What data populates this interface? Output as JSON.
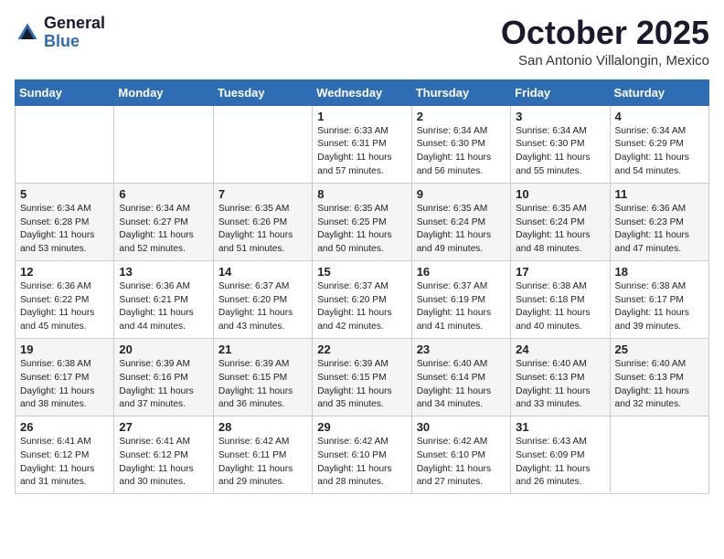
{
  "header": {
    "logo_general": "General",
    "logo_blue": "Blue",
    "month": "October 2025",
    "location": "San Antonio Villalongin, Mexico"
  },
  "weekdays": [
    "Sunday",
    "Monday",
    "Tuesday",
    "Wednesday",
    "Thursday",
    "Friday",
    "Saturday"
  ],
  "weeks": [
    [
      {
        "day": "",
        "info": ""
      },
      {
        "day": "",
        "info": ""
      },
      {
        "day": "",
        "info": ""
      },
      {
        "day": "1",
        "info": "Sunrise: 6:33 AM\nSunset: 6:31 PM\nDaylight: 11 hours\nand 57 minutes."
      },
      {
        "day": "2",
        "info": "Sunrise: 6:34 AM\nSunset: 6:30 PM\nDaylight: 11 hours\nand 56 minutes."
      },
      {
        "day": "3",
        "info": "Sunrise: 6:34 AM\nSunset: 6:30 PM\nDaylight: 11 hours\nand 55 minutes."
      },
      {
        "day": "4",
        "info": "Sunrise: 6:34 AM\nSunset: 6:29 PM\nDaylight: 11 hours\nand 54 minutes."
      }
    ],
    [
      {
        "day": "5",
        "info": "Sunrise: 6:34 AM\nSunset: 6:28 PM\nDaylight: 11 hours\nand 53 minutes."
      },
      {
        "day": "6",
        "info": "Sunrise: 6:34 AM\nSunset: 6:27 PM\nDaylight: 11 hours\nand 52 minutes."
      },
      {
        "day": "7",
        "info": "Sunrise: 6:35 AM\nSunset: 6:26 PM\nDaylight: 11 hours\nand 51 minutes."
      },
      {
        "day": "8",
        "info": "Sunrise: 6:35 AM\nSunset: 6:25 PM\nDaylight: 11 hours\nand 50 minutes."
      },
      {
        "day": "9",
        "info": "Sunrise: 6:35 AM\nSunset: 6:24 PM\nDaylight: 11 hours\nand 49 minutes."
      },
      {
        "day": "10",
        "info": "Sunrise: 6:35 AM\nSunset: 6:24 PM\nDaylight: 11 hours\nand 48 minutes."
      },
      {
        "day": "11",
        "info": "Sunrise: 6:36 AM\nSunset: 6:23 PM\nDaylight: 11 hours\nand 47 minutes."
      }
    ],
    [
      {
        "day": "12",
        "info": "Sunrise: 6:36 AM\nSunset: 6:22 PM\nDaylight: 11 hours\nand 45 minutes."
      },
      {
        "day": "13",
        "info": "Sunrise: 6:36 AM\nSunset: 6:21 PM\nDaylight: 11 hours\nand 44 minutes."
      },
      {
        "day": "14",
        "info": "Sunrise: 6:37 AM\nSunset: 6:20 PM\nDaylight: 11 hours\nand 43 minutes."
      },
      {
        "day": "15",
        "info": "Sunrise: 6:37 AM\nSunset: 6:20 PM\nDaylight: 11 hours\nand 42 minutes."
      },
      {
        "day": "16",
        "info": "Sunrise: 6:37 AM\nSunset: 6:19 PM\nDaylight: 11 hours\nand 41 minutes."
      },
      {
        "day": "17",
        "info": "Sunrise: 6:38 AM\nSunset: 6:18 PM\nDaylight: 11 hours\nand 40 minutes."
      },
      {
        "day": "18",
        "info": "Sunrise: 6:38 AM\nSunset: 6:17 PM\nDaylight: 11 hours\nand 39 minutes."
      }
    ],
    [
      {
        "day": "19",
        "info": "Sunrise: 6:38 AM\nSunset: 6:17 PM\nDaylight: 11 hours\nand 38 minutes."
      },
      {
        "day": "20",
        "info": "Sunrise: 6:39 AM\nSunset: 6:16 PM\nDaylight: 11 hours\nand 37 minutes."
      },
      {
        "day": "21",
        "info": "Sunrise: 6:39 AM\nSunset: 6:15 PM\nDaylight: 11 hours\nand 36 minutes."
      },
      {
        "day": "22",
        "info": "Sunrise: 6:39 AM\nSunset: 6:15 PM\nDaylight: 11 hours\nand 35 minutes."
      },
      {
        "day": "23",
        "info": "Sunrise: 6:40 AM\nSunset: 6:14 PM\nDaylight: 11 hours\nand 34 minutes."
      },
      {
        "day": "24",
        "info": "Sunrise: 6:40 AM\nSunset: 6:13 PM\nDaylight: 11 hours\nand 33 minutes."
      },
      {
        "day": "25",
        "info": "Sunrise: 6:40 AM\nSunset: 6:13 PM\nDaylight: 11 hours\nand 32 minutes."
      }
    ],
    [
      {
        "day": "26",
        "info": "Sunrise: 6:41 AM\nSunset: 6:12 PM\nDaylight: 11 hours\nand 31 minutes."
      },
      {
        "day": "27",
        "info": "Sunrise: 6:41 AM\nSunset: 6:12 PM\nDaylight: 11 hours\nand 30 minutes."
      },
      {
        "day": "28",
        "info": "Sunrise: 6:42 AM\nSunset: 6:11 PM\nDaylight: 11 hours\nand 29 minutes."
      },
      {
        "day": "29",
        "info": "Sunrise: 6:42 AM\nSunset: 6:10 PM\nDaylight: 11 hours\nand 28 minutes."
      },
      {
        "day": "30",
        "info": "Sunrise: 6:42 AM\nSunset: 6:10 PM\nDaylight: 11 hours\nand 27 minutes."
      },
      {
        "day": "31",
        "info": "Sunrise: 6:43 AM\nSunset: 6:09 PM\nDaylight: 11 hours\nand 26 minutes."
      },
      {
        "day": "",
        "info": ""
      }
    ]
  ]
}
